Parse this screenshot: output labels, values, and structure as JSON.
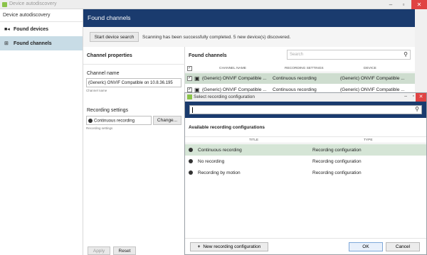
{
  "window": {
    "title": "Device autodiscovery",
    "minimize": "–",
    "maximize": "▫",
    "close": "✕"
  },
  "sidebar": {
    "header": "Device autodiscovery",
    "items": [
      {
        "label": "Found devices",
        "icon": "camera-icon",
        "glyph": "■◂"
      },
      {
        "label": "Found channels",
        "icon": "channels-icon",
        "glyph": "⊞"
      }
    ]
  },
  "header": {
    "title": "Found channels"
  },
  "toolbar": {
    "search_button": "Start device search",
    "status": "Scanning has been successfully completed. 5 new device(s) discovered."
  },
  "channel_properties": {
    "title": "Channel properties",
    "name_label": "Channel name",
    "name_value": "(Generic) ONVIF Compatible on 10.8.36.195",
    "name_hint": "Channel name",
    "rec_label": "Recording settings",
    "rec_value": "Continuous recording",
    "rec_hint": "Recording settings",
    "change_button": "Change...",
    "apply_button": "Apply",
    "reset_button": "Reset"
  },
  "found_channels": {
    "title": "Found channels",
    "search_placeholder": "Search",
    "columns": [
      "CHANNEL NAME",
      "RECORDING SETTINGS",
      "DEVICE"
    ],
    "rows": [
      {
        "name": "(Generic) ONVIF Compatible ...",
        "settings": "Continuous recording",
        "device": "(Generic) ONVIF Compatible ..."
      },
      {
        "name": "(Generic) ONVIF Compatible ...",
        "settings": "Continuous recording",
        "device": "(Generic) ONVIF Compatible ..."
      }
    ]
  },
  "dialog": {
    "title": "Select recording configuration",
    "section_title": "Available recording configurations",
    "columns": [
      "TITLE",
      "TYPE"
    ],
    "rows": [
      {
        "title": "Continuous recording",
        "type": "Recording configuration"
      },
      {
        "title": "No recording",
        "type": "Recording configuration"
      },
      {
        "title": "Recording by motion",
        "type": "Recording configuration"
      }
    ],
    "new_button": "New recording configuration",
    "ok_button": "OK",
    "cancel_button": "Cancel",
    "minimize": "–",
    "maximize": "▫",
    "close": "✕"
  },
  "colors": {
    "header_navy": "#1a3b6e",
    "selection_green": "#ceddcf",
    "sidebar_active": "#c8dce6",
    "close_red": "#e04343",
    "app_icon": "#8bc34a"
  }
}
